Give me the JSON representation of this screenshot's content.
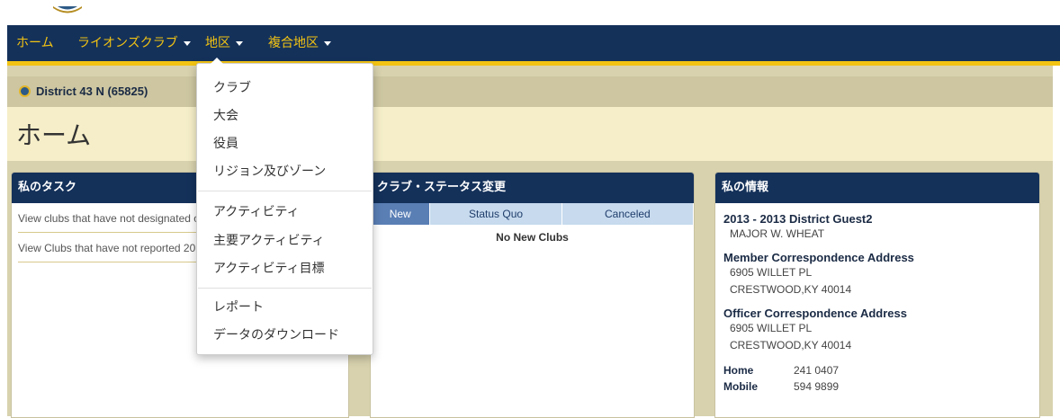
{
  "nav": {
    "home": "ホーム",
    "lions_club": "ライオンズクラブ",
    "district": "地区",
    "multi_district": "複合地区"
  },
  "district": {
    "name": "District 43 N (65825)"
  },
  "page_title": "ホーム",
  "tasks_panel": {
    "title": "私のタスク",
    "items": [
      "View clubs that have not designated officers (PU-101)",
      "View Clubs that have not reported 2013"
    ]
  },
  "status_panel": {
    "title": "クラブ・ステータス変更",
    "tabs": [
      "New",
      "Status Quo",
      "Canceled"
    ],
    "empty": "No New Clubs"
  },
  "info_panel": {
    "title": "私の情報",
    "role": "2013 - 2013 District Guest2",
    "name": "MAJOR W. WHEAT",
    "member_heading": "Member Correspondence Address",
    "member_street": "6905 WILLET PL",
    "member_city": "CRESTWOOD,KY 40014",
    "officer_heading": "Officer Correspondence Address",
    "officer_street": "6905 WILLET PL",
    "officer_city": "CRESTWOOD,KY 40014",
    "home_label": "Home",
    "home_value": "241 0407",
    "mobile_label": "Mobile",
    "mobile_value": "594 9899"
  },
  "district_menu": {
    "items": [
      "クラブ",
      "大会",
      "役員",
      "リジョン及びゾーン",
      "アクティビティ",
      "主要アクティビティ",
      "アクティビティ目標",
      "レポート",
      "データのダウンロード"
    ]
  },
  "colors": {
    "nav_bg": "#14315a",
    "accent": "#f2c313",
    "tab_active": "#5a7fb5"
  }
}
